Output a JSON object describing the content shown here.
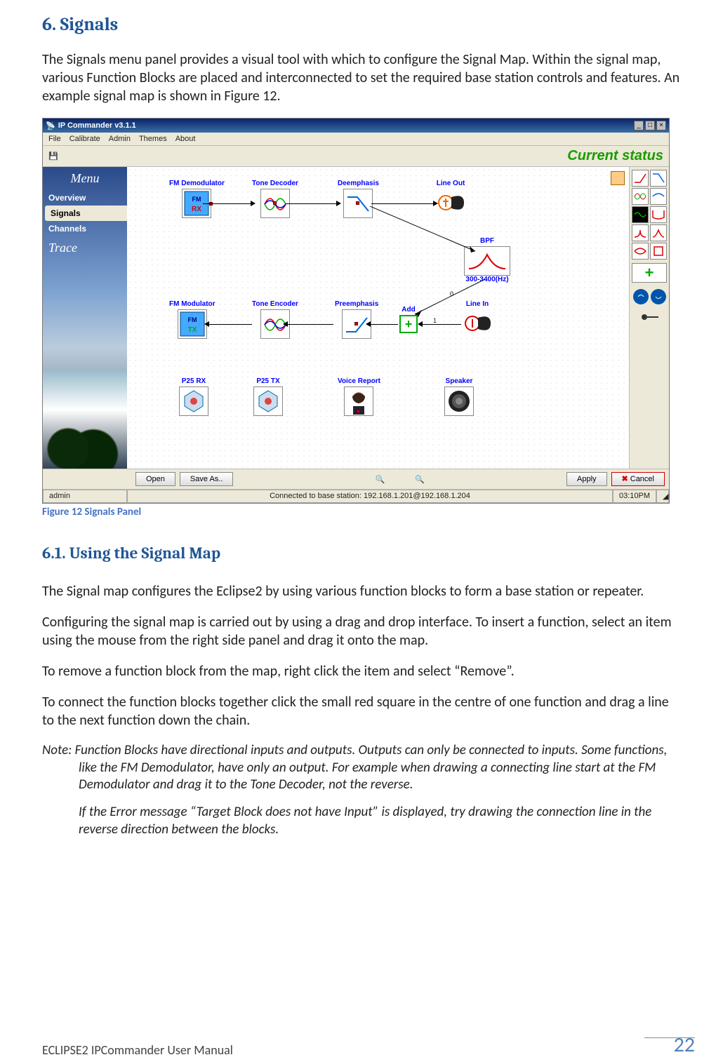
{
  "section": {
    "number": "6.",
    "title": "Signals"
  },
  "intro": "The Signals menu panel provides a visual tool with which to configure the Signal Map. Within the signal map, various Function Blocks are placed and interconnected to set the required base station controls and features.  An example signal map is shown in Figure 12.",
  "figure_caption": "Figure 12 Signals Panel",
  "subsection": {
    "number": "6.1.",
    "title": "Using the Signal Map"
  },
  "p1": "The Signal map configures the Eclipse2 by using various function blocks to form a base station or repeater.",
  "p2": "Configuring the signal map is carried out by using a drag and drop interface. To insert a function, select an item using the mouse from the right side panel and drag it onto the map.",
  "p3": "To remove a function block from the map, right click the item and select “Remove”.",
  "p4": "To connect the function blocks together click the small red square in the centre of one function and drag a line to the next function down the chain.",
  "note1": "Note: Function Blocks have directional inputs and outputs.  Outputs can only be connected to inputs.  Some functions, like the FM Demodulator, have only an output.  For example when drawing a connecting line start at the FM Demodulator and drag it to the Tone Decoder, not the reverse.",
  "note2": "If the Error message “Target Block does not have Input” is displayed, try drawing the connection line in the reverse direction between the blocks.",
  "footer": {
    "title": "ECLIPSE2 IPCommander User Manual",
    "page": "22"
  },
  "app": {
    "title": "IP Commander v3.1.1",
    "menu": [
      "File",
      "Calibrate",
      "Admin",
      "Themes",
      "About"
    ],
    "status_banner": "Current status",
    "sidebar": {
      "heading": "Menu",
      "items": [
        "Overview",
        "Signals",
        "Channels"
      ],
      "selected": 1,
      "trace": "Trace"
    },
    "blocks": {
      "fm_demod": "FM Demodulator",
      "tone_dec": "Tone Decoder",
      "deemph": "Deemphasis",
      "line_out": "Line Out",
      "bpf": "BPF",
      "bpf_sub": "300-3400(Hz)",
      "fm_mod": "FM Modulator",
      "tone_enc": "Tone Encoder",
      "preemph": "Preemphasis",
      "add": "Add",
      "line_in": "Line In",
      "p25rx": "P25 RX",
      "p25tx": "P25 TX",
      "voice": "Voice Report",
      "speaker": "Speaker"
    },
    "palette_plus": "+",
    "buttons": {
      "open": "Open",
      "save": "Save As..",
      "apply": "Apply",
      "cancel": "Cancel"
    },
    "statusbar": {
      "user": "admin",
      "conn": "Connected to base station: 192.168.1.201@192.168.1.204",
      "time": "03:10PM"
    }
  }
}
